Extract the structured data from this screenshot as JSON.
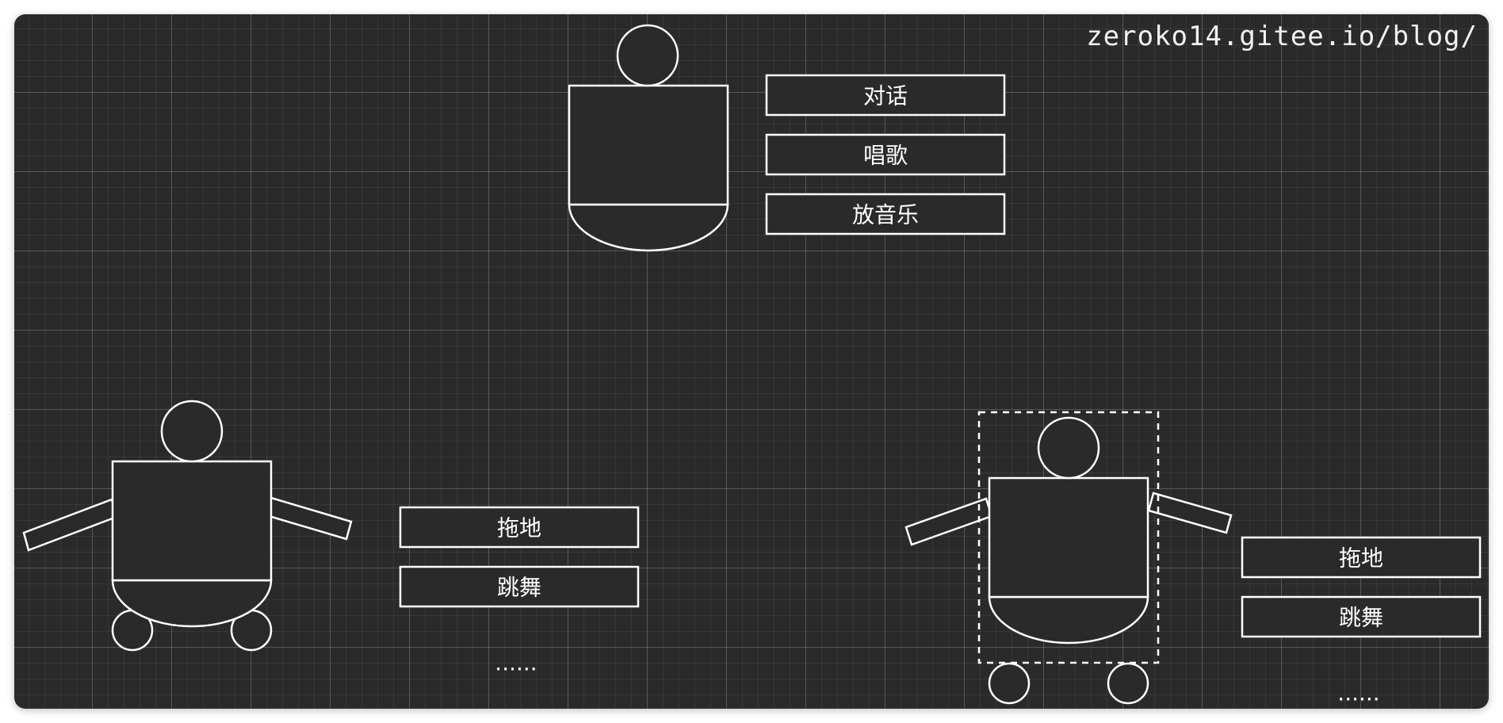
{
  "watermark": "zeroko14.gitee.io/blog/",
  "robot_top": {
    "actions": [
      "对话",
      "唱歌",
      "放音乐"
    ]
  },
  "robot_left": {
    "actions": [
      "拖地",
      "跳舞"
    ],
    "more": "......"
  },
  "robot_right": {
    "actions": [
      "拖地",
      "跳舞"
    ],
    "more": "......"
  }
}
